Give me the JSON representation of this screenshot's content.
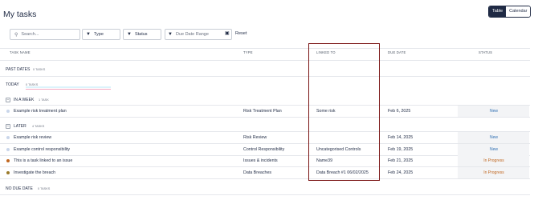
{
  "page": {
    "title": "My tasks"
  },
  "view_toggle": {
    "table": "Table",
    "calendar": "Calendar"
  },
  "filters": {
    "search_placeholder": "Search...",
    "type_label": "Type",
    "status_label": "Status",
    "date_placeholder": "Due Date Range",
    "reset_label": "Reset"
  },
  "columns": {
    "task_name": "TASK NAME",
    "type": "TYPE",
    "linked_to": "LINKED TO",
    "due_date": "DUE DATE",
    "status": "STATUS"
  },
  "groups": {
    "past": {
      "label": "PAST DATES",
      "count": "0 TASKS"
    },
    "today": {
      "label": "TODAY",
      "count": "0 TASKS"
    },
    "week": {
      "label": "IN A WEEK",
      "count": "1 TASK"
    },
    "later": {
      "label": "LATER",
      "count": "4 TASKS"
    },
    "none": {
      "label": "NO DUE DATE",
      "count": "0 TASKS"
    }
  },
  "week_rows": [
    {
      "name": "Example risk treatment plan",
      "type": "Risk Treatment Plan",
      "linked": "Some risk",
      "due": "Feb 6, 2025",
      "status": "New",
      "dot": "#c9d6ea",
      "status_color": "#2f6fb3"
    }
  ],
  "later_rows": [
    {
      "name": "Example risk review",
      "type": "Risk Review",
      "linked": "",
      "due": "Feb 14, 2025",
      "status": "New",
      "dot": "#c9d6ea",
      "status_color": "#2f6fb3"
    },
    {
      "name": "Example control responsibility",
      "type": "Control Responsibility",
      "linked": "Uncategorised Controls",
      "due": "Feb 19, 2025",
      "status": "New",
      "dot": "#c9d6ea",
      "status_color": "#2f6fb3"
    },
    {
      "name": "This is a task linked to an issue",
      "type": "Issues & incidents",
      "linked": "Name39",
      "due": "Feb 21, 2025",
      "status": "In Progress",
      "dot": "#c0661f",
      "status_color": "#c0661f"
    },
    {
      "name": "Investigate the breach",
      "type": "Data Breaches",
      "linked": "Data Breach #1 06/02/2025",
      "due": "Feb 24, 2025",
      "status": "In Progress",
      "dot": "#9a7a2a",
      "status_color": "#c0661f"
    }
  ],
  "icons": {
    "search": "search-icon",
    "filter": "filter-icon",
    "calendar": "calendar-icon"
  },
  "colors": {
    "navy": "#1f2a44",
    "highlight_border": "#7a1414",
    "new": "#2f6fb3",
    "in_progress": "#c0661f"
  }
}
